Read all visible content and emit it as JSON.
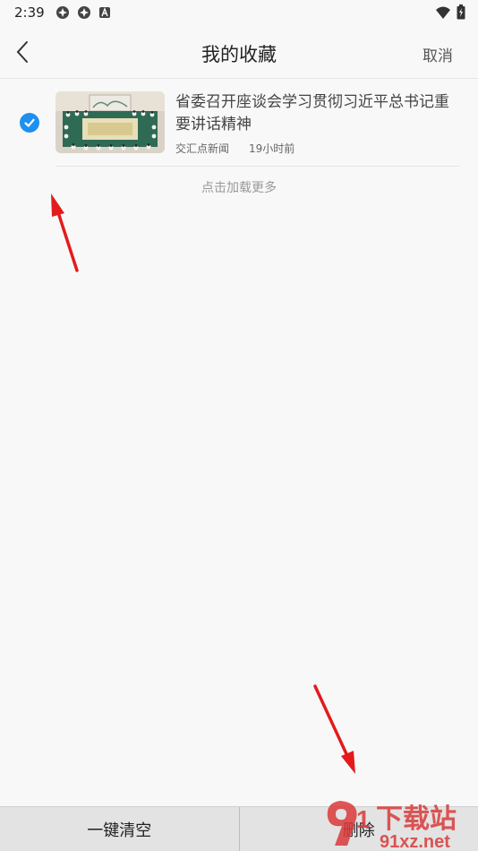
{
  "status_bar": {
    "time": "2:39",
    "left_icons": [
      "app-notification-icon",
      "app-notification-icon",
      "a-badge-icon"
    ],
    "right_icons": [
      "wifi-icon",
      "battery-icon"
    ]
  },
  "header": {
    "title": "我的收藏",
    "cancel_label": "取消",
    "back_icon": "back-chevron-icon"
  },
  "favorites": [
    {
      "selected": true,
      "title": "省委召开座谈会学习贯彻习近平总书记重要讲话精神",
      "source": "交汇点新闻",
      "time": "19小时前"
    }
  ],
  "load_more_label": "点击加载更多",
  "bottom_bar": {
    "clear_all_label": "一键清空",
    "delete_label": "删除"
  },
  "watermark": {
    "logo_text": "91",
    "brand_text": "下载站",
    "url_text": "91xz.net"
  },
  "colors": {
    "accent": "#1e90f0",
    "arrow": "#e31b1b",
    "watermark": "#d93a3a"
  }
}
